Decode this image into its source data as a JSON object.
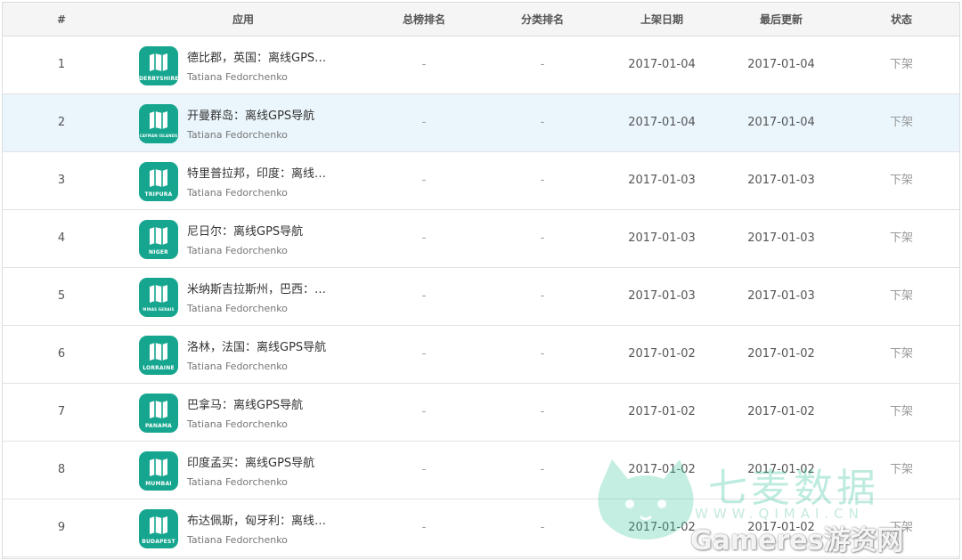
{
  "table": {
    "headers": {
      "rank": "#",
      "app": "应用",
      "overall_rank": "总榜排名",
      "category_rank": "分类排名",
      "listed_date": "上架日期",
      "last_update": "最后更新",
      "status": "状态"
    },
    "rows": [
      {
        "rank": "1",
        "name": "德比郡，英国：离线GPS导航",
        "developer": "Tatiana Fedorchenko",
        "icon_caption": "DERBYSHIRE",
        "overall_rank": "-",
        "category_rank": "-",
        "listed_date": "2017-01-04",
        "last_update": "2017-01-04",
        "status": "下架"
      },
      {
        "rank": "2",
        "name": "开曼群岛：离线GPS导航",
        "developer": "Tatiana Fedorchenko",
        "icon_caption": "CAYMAN ISLANDS",
        "overall_rank": "-",
        "category_rank": "-",
        "listed_date": "2017-01-04",
        "last_update": "2017-01-04",
        "status": "下架"
      },
      {
        "rank": "3",
        "name": "特里普拉邦，印度：离线GPS导航",
        "developer": "Tatiana Fedorchenko",
        "icon_caption": "TRIPURA",
        "overall_rank": "-",
        "category_rank": "-",
        "listed_date": "2017-01-03",
        "last_update": "2017-01-03",
        "status": "下架"
      },
      {
        "rank": "4",
        "name": "尼日尔：离线GPS导航",
        "developer": "Tatiana Fedorchenko",
        "icon_caption": "NIGER",
        "overall_rank": "-",
        "category_rank": "-",
        "listed_date": "2017-01-03",
        "last_update": "2017-01-03",
        "status": "下架"
      },
      {
        "rank": "5",
        "name": "米纳斯吉拉斯州，巴西：离线GPS导航",
        "developer": "Tatiana Fedorchenko",
        "icon_caption": "MINAS GERAIS",
        "overall_rank": "-",
        "category_rank": "-",
        "listed_date": "2017-01-03",
        "last_update": "2017-01-03",
        "status": "下架"
      },
      {
        "rank": "6",
        "name": "洛林，法国：离线GPS导航",
        "developer": "Tatiana Fedorchenko",
        "icon_caption": "LORRAINE",
        "overall_rank": "-",
        "category_rank": "-",
        "listed_date": "2017-01-02",
        "last_update": "2017-01-02",
        "status": "下架"
      },
      {
        "rank": "7",
        "name": "巴拿马：离线GPS导航",
        "developer": "Tatiana Fedorchenko",
        "icon_caption": "PANAMA",
        "overall_rank": "-",
        "category_rank": "-",
        "listed_date": "2017-01-02",
        "last_update": "2017-01-02",
        "status": "下架"
      },
      {
        "rank": "8",
        "name": "印度孟买：离线GPS导航",
        "developer": "Tatiana Fedorchenko",
        "icon_caption": "MUMBAI",
        "overall_rank": "-",
        "category_rank": "-",
        "listed_date": "2017-01-02",
        "last_update": "2017-01-02",
        "status": "下架"
      },
      {
        "rank": "9",
        "name": "布达佩斯，匈牙利：离线GPS导航",
        "developer": "Tatiana Fedorchenko",
        "icon_caption": "BUDAPEST",
        "overall_rank": "-",
        "category_rank": "-",
        "listed_date": "2017-01-02",
        "last_update": "2017-01-02",
        "status": "下架"
      }
    ]
  },
  "watermark": {
    "brand": "七麦数据",
    "url": "WWW.QIMAI.CN",
    "overlay": "Gameres游资网"
  },
  "colors": {
    "icon_bg": "#16a68f",
    "highlight_row": "#eaf6fc",
    "header_bg": "#f5f5f5"
  }
}
